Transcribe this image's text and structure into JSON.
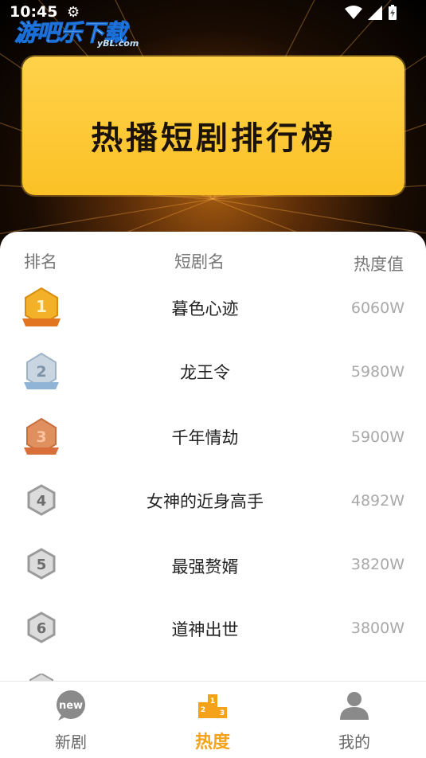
{
  "status_bar": {
    "time": "10:45"
  },
  "watermark": {
    "text_cn": "游吧乐下载",
    "text_en": "yBL.com"
  },
  "banner": {
    "title": "热播短剧排行榜"
  },
  "table": {
    "headers": {
      "rank": "排名",
      "name": "短剧名",
      "heat": "热度值"
    },
    "rows": [
      {
        "rank": "1",
        "name": "暮色心迹",
        "heat": "6060W"
      },
      {
        "rank": "2",
        "name": "龙王令",
        "heat": "5980W"
      },
      {
        "rank": "3",
        "name": "千年情劫",
        "heat": "5900W"
      },
      {
        "rank": "4",
        "name": "女神的近身高手",
        "heat": "4892W"
      },
      {
        "rank": "5",
        "name": "最强赘婿",
        "heat": "3820W"
      },
      {
        "rank": "6",
        "name": "道神出世",
        "heat": "3800W"
      }
    ]
  },
  "tabs": [
    {
      "label": "新剧",
      "icon": "new-icon",
      "icon_text": "new",
      "active": false
    },
    {
      "label": "热度",
      "icon": "podium-icon",
      "active": true
    },
    {
      "label": "我的",
      "icon": "person-icon",
      "active": false
    }
  ],
  "colors": {
    "accent": "#f4a21a",
    "banner": "#fbc126",
    "gold": "#f3b12a",
    "silver": "#b8c8d6",
    "bronze": "#e0905e"
  }
}
